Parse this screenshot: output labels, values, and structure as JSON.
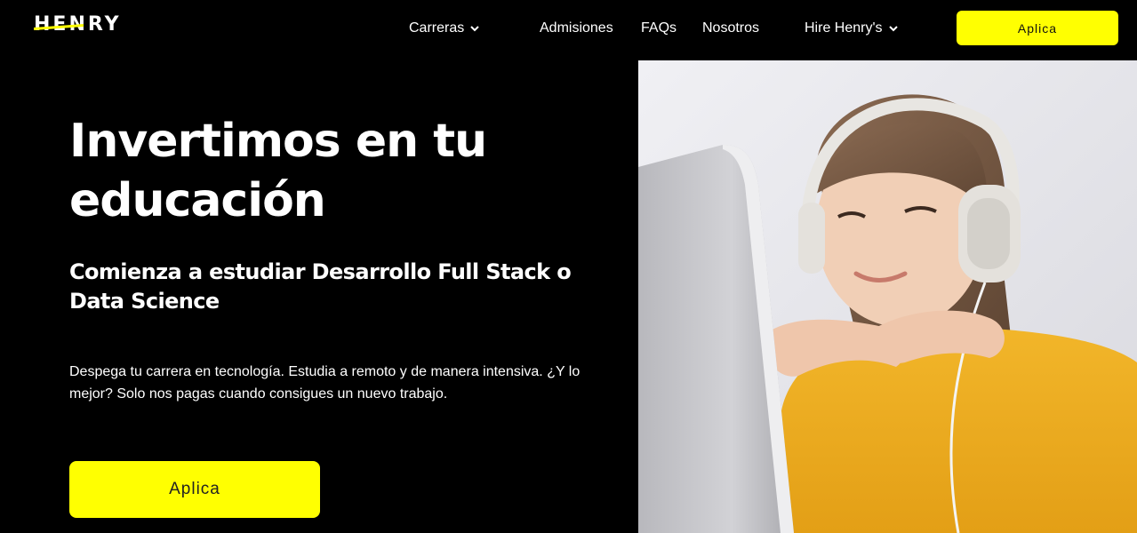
{
  "header": {
    "logo": "HENRY",
    "nav": [
      {
        "label": "Carreras",
        "has_dropdown": true
      },
      {
        "label": "Admisiones",
        "has_dropdown": false
      },
      {
        "label": "FAQs",
        "has_dropdown": false
      },
      {
        "label": "Nosotros",
        "has_dropdown": false
      },
      {
        "label": "Hire Henry's",
        "has_dropdown": true
      }
    ],
    "cta_label": "Aplica"
  },
  "hero": {
    "title": "Invertimos en tu educación",
    "subtitle": "Comienza a estudiar Desarrollo Full Stack o Data Science",
    "description": "Despega tu carrera en tecnología. Estudia a remoto y de manera intensiva. ¿Y lo mejor? Solo nos pagas cuando consigues un nuevo trabajo.",
    "cta_label": "Aplica"
  },
  "colors": {
    "background": "#000000",
    "accent": "#ffff01",
    "text": "#ffffff"
  },
  "icons": {
    "dropdown": "chevron-down-icon"
  }
}
